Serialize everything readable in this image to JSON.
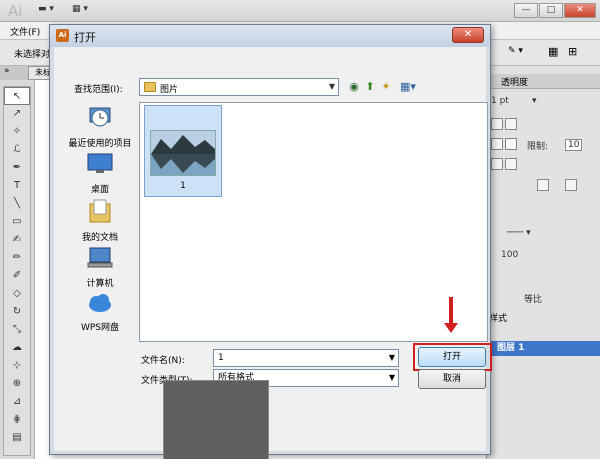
{
  "app": {
    "logo": "Ai",
    "menu_file": "文件(F)",
    "control_text": "未选择对",
    "doc_tab": "未标",
    "right_tab": "透明度",
    "stroke_weight": "1 pt",
    "limit_label": "限制:",
    "limit_value": "10",
    "opacity_value": "100",
    "ratio_label": "等比",
    "stroke_section": "样式",
    "layer_name": "图层 1",
    "window_buttons": [
      "—",
      "□",
      "✕"
    ]
  },
  "dialog": {
    "title": "打开",
    "close_label": "✕",
    "look_in_label": "查找范围(I):",
    "look_in_value": "图片",
    "places": [
      {
        "label": "最近使用的项目",
        "icon": "recent-items-icon"
      },
      {
        "label": "桌面",
        "icon": "desktop-icon"
      },
      {
        "label": "我的文档",
        "icon": "documents-icon"
      },
      {
        "label": "计算机",
        "icon": "computer-icon"
      },
      {
        "label": "WPS网盘",
        "icon": "cloud-icon"
      }
    ],
    "files": [
      {
        "name": "1",
        "icon": "image-thumbnail"
      }
    ],
    "file_name_label": "文件名(N):",
    "file_name_value": "1",
    "file_type_label": "文件类型(T):",
    "file_type_value": "所有格式",
    "open_button": "打开",
    "cancel_button": "取消"
  },
  "colors": {
    "highlight": "#d11f1f",
    "selection": "#cde2f6",
    "layer_active": "#3f76c9"
  }
}
